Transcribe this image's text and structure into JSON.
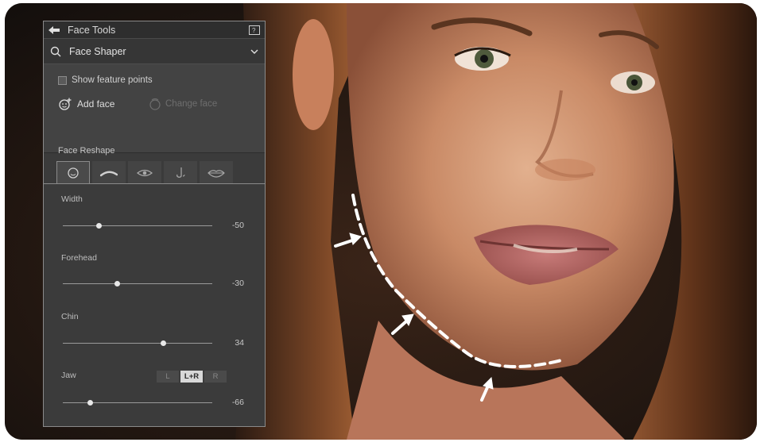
{
  "panel": {
    "title": "Face Tools",
    "tool": {
      "label": "Face Shaper"
    },
    "show_feature_points": {
      "label": "Show feature points"
    },
    "add_face": {
      "label": "Add face"
    },
    "change_face": {
      "label": "Change face"
    },
    "section_title": "Face Reshape",
    "tabs": [
      "face-icon",
      "eyebrow-icon",
      "eye-icon",
      "nose-icon",
      "lips-icon"
    ],
    "sliders": [
      {
        "label": "Width",
        "value": "-50",
        "position": 0.24
      },
      {
        "label": "Forehead",
        "value": "-30",
        "position": 0.36
      },
      {
        "label": "Chin",
        "value": "34",
        "position": 0.67
      },
      {
        "label": "Jaw",
        "value": "-66",
        "position": 0.18
      }
    ],
    "jaw_toggle": [
      "L",
      "L+R",
      "R"
    ],
    "jaw_toggle_selected": "L+R"
  },
  "colors": {
    "panel_bg": "#3b3b3b",
    "panel_border": "#8a8a8a",
    "text": "#e0e0e0",
    "dashed_line": "#ffffff"
  }
}
